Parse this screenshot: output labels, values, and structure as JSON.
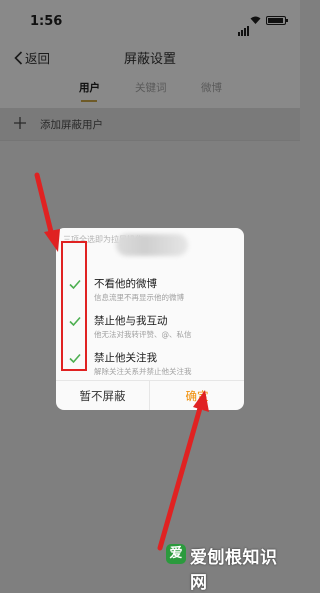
{
  "status": {
    "time": "1:56"
  },
  "nav": {
    "back_label": "返回",
    "title": "屏蔽设置"
  },
  "tabs": [
    {
      "label": "用户"
    },
    {
      "label": "关键词"
    },
    {
      "label": "微博"
    }
  ],
  "add_row": {
    "label": "添加屏蔽用户"
  },
  "dialog": {
    "hint": "三项全选即为拉黑操作",
    "options": [
      {
        "title": "不看他的微博",
        "desc": "信息流里不再显示他的微博",
        "checked": true
      },
      {
        "title": "禁止他与我互动",
        "desc": "他无法对我转评赞、@、私信",
        "checked": true
      },
      {
        "title": "禁止他关注我",
        "desc": "解除关注关系并禁止他关注我",
        "checked": true
      }
    ],
    "cancel_label": "暂不屏蔽",
    "confirm_label": "确定"
  },
  "watermark": {
    "logo_text": "爱",
    "text": "爱刨根知识网"
  },
  "colors": {
    "accent": "#f08c00",
    "check": "#4caf50",
    "highlight": "#e02222"
  }
}
